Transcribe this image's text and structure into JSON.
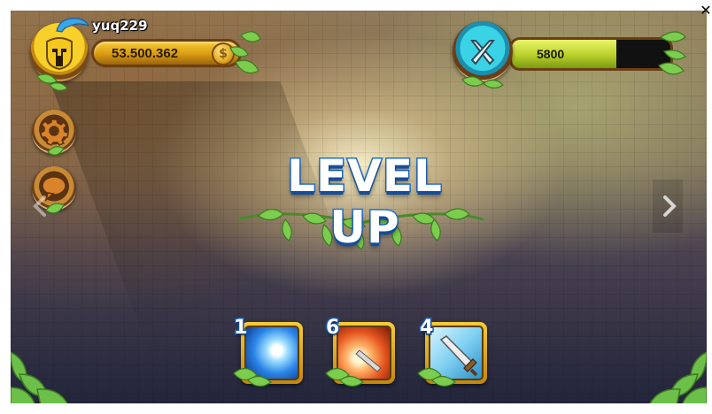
{
  "player": {
    "username": "yuq229",
    "coins": "53.500.362",
    "coin_symbol": "$"
  },
  "xp": {
    "value": "5800",
    "fill_fraction": 0.66
  },
  "title": "LEVEL UP",
  "skills": [
    {
      "number": "1",
      "icon": "blue-energy-burst-icon"
    },
    {
      "number": "6",
      "icon": "fire-sword-slash-icon"
    },
    {
      "number": "4",
      "icon": "sword-icon"
    }
  ],
  "icons": {
    "avatar": "golden-helmet-icon",
    "settings": "gear-icon",
    "chat": "chat-bubble-icon",
    "xp": "crossed-swords-icon",
    "nav_left": "chevron-left-icon",
    "nav_right": "chevron-right-icon",
    "close": "close-icon"
  },
  "colors": {
    "title_outline": "#1f6fd4",
    "coin_bar": "#f8cc33",
    "xp_fill": "#b9d02a",
    "leaf": "#6cc04a"
  }
}
